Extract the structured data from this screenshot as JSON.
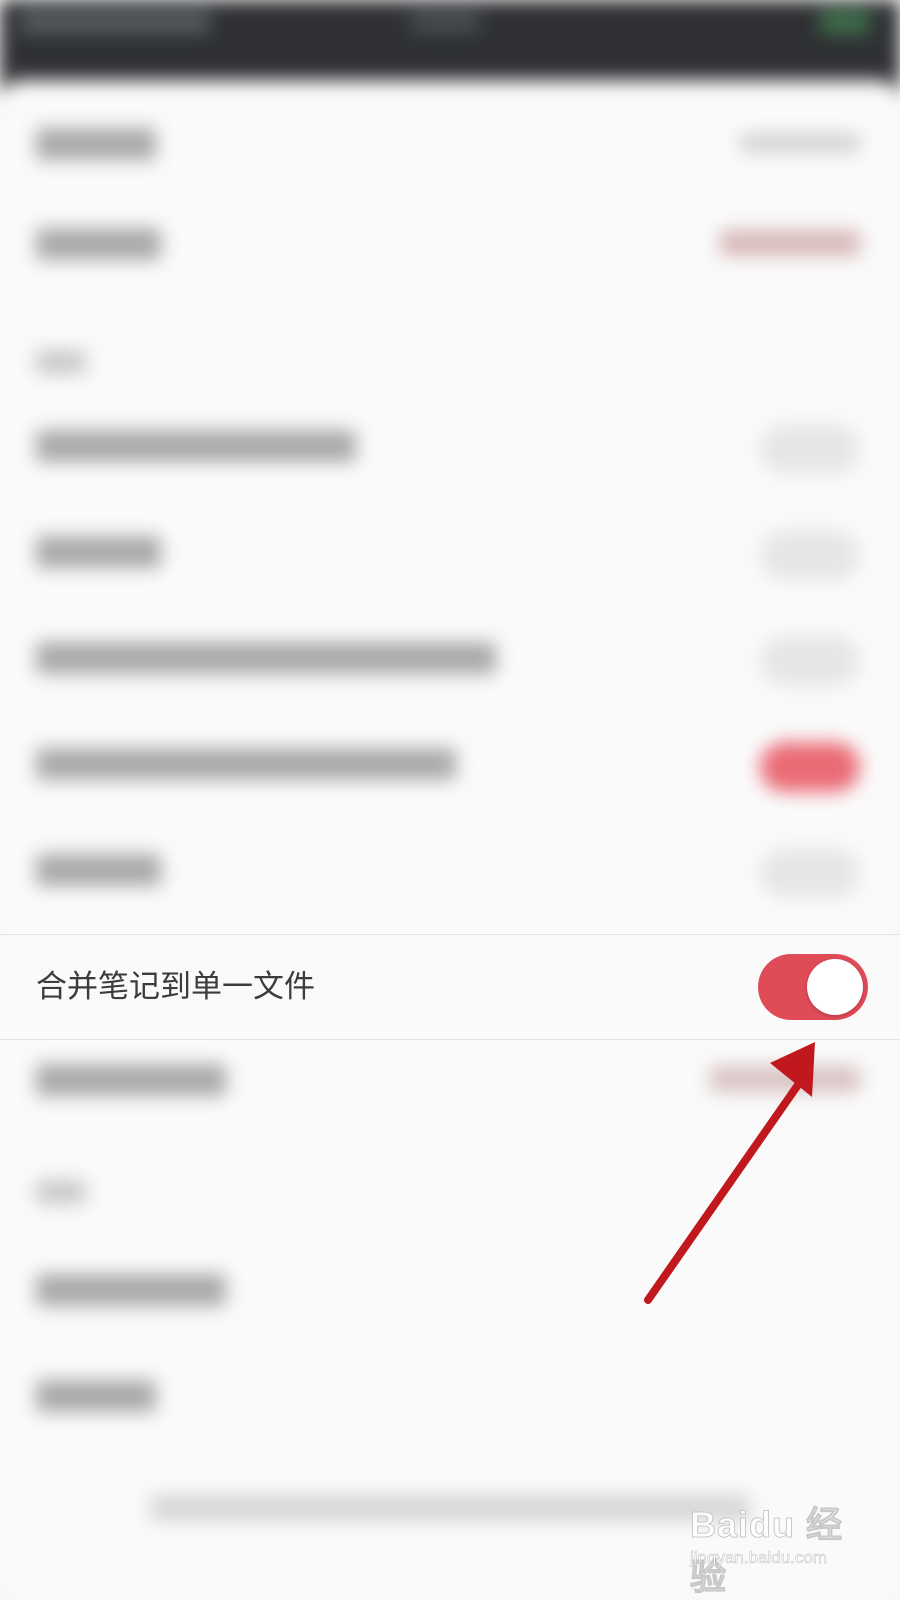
{
  "setting_row": {
    "label": "合并笔记到单一文件",
    "toggle_state": "on"
  },
  "colors": {
    "accent": "#df4b57",
    "annotation_arrow": "#c0181c",
    "background": "#fafafa"
  },
  "icons": {
    "annotation": "arrow-pointer-icon",
    "watermark": "baidu-paw-icon"
  },
  "watermark": {
    "main": "Baidu 经验",
    "sub": "jingyan.baidu.com"
  }
}
